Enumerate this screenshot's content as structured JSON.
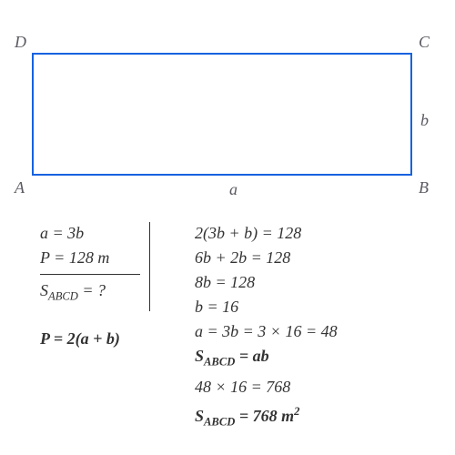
{
  "vertices": {
    "A": "A",
    "B": "B",
    "C": "C",
    "D": "D"
  },
  "sides": {
    "a": "a",
    "b": "b"
  },
  "given": {
    "line1_lhs": "a",
    "line1_eq": " = ",
    "line1_rhs": "3b",
    "line2_lhs": "P",
    "line2_eq": " = ",
    "line2_rhs": "128 m",
    "find_lhs": "S",
    "find_sub": "ABCD",
    "find_eq": " = ?"
  },
  "formula": {
    "lhs": "P",
    "eq": " = ",
    "rhs": "2(a + b)"
  },
  "solution": {
    "s1": "2(3b + b) = 128",
    "s2": "6b + 2b = 128",
    "s3": "8b = 128",
    "s4": "b = 16",
    "s5": "a = 3b = 3 × 16 = 48",
    "s6_lhs": "S",
    "s6_sub": "ABCD",
    "s6_rhs": " = ab",
    "s7": "48 × 16 = 768",
    "s8_lhs": "S",
    "s8_sub": "ABCD",
    "s8_rhs_a": " = 768 m",
    "s8_exp": "2"
  },
  "chart_data": {
    "type": "diagram",
    "shape": "rectangle",
    "vertices": [
      "A",
      "B",
      "C",
      "D"
    ],
    "vertex_positions": {
      "A": "bottom-left",
      "B": "bottom-right",
      "C": "top-right",
      "D": "top-left"
    },
    "side_labels": {
      "bottom": "a",
      "right": "b"
    },
    "given": {
      "a_relation": "a = 3b",
      "perimeter": 128,
      "perimeter_unit": "m"
    },
    "unknown": "S_ABCD (area)",
    "perimeter_formula": "P = 2(a + b)",
    "area_formula": "S_ABCD = a*b",
    "derived": {
      "b": 16,
      "a": 48,
      "area": 768,
      "area_unit": "m^2"
    },
    "steps": [
      "2(3b + b) = 128",
      "6b + 2b = 128",
      "8b = 128",
      "b = 16",
      "a = 3b = 3 × 16 = 48",
      "S_ABCD = ab",
      "48 × 16 = 768",
      "S_ABCD = 768 m^2"
    ]
  }
}
